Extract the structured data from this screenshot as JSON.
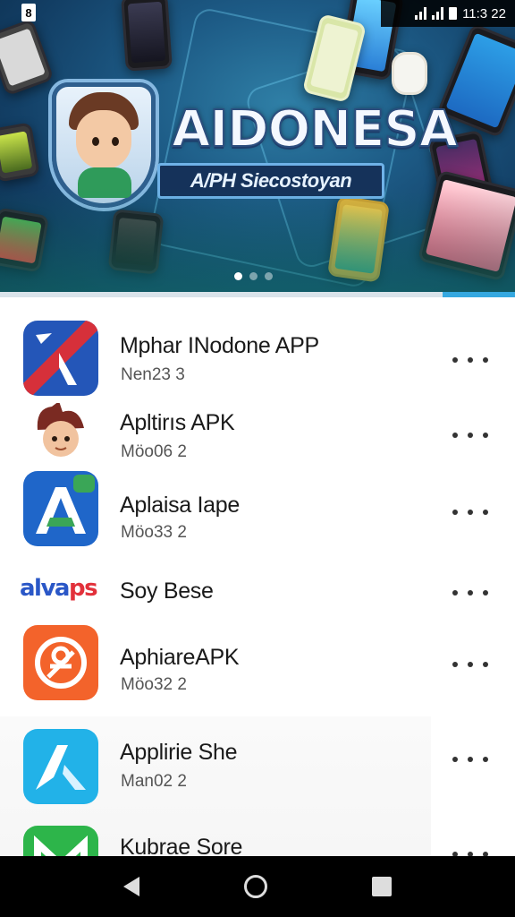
{
  "status_bar": {
    "time": "11:3 22",
    "sim_glyph": "8"
  },
  "banner": {
    "title": "AIDONESA",
    "subtitle": "A/PH Siecostoyan",
    "carousel": {
      "pages": 3,
      "active": 1
    }
  },
  "apps": [
    {
      "title": "Mphar INodone APP",
      "subtitle": "Nen23 3",
      "icon": "blue-slash-icon",
      "colors": [
        "#2456b8",
        "#d6303a"
      ]
    },
    {
      "title": "Apltirıs APK",
      "subtitle": "Möo06 2",
      "icon": "mascot-icon",
      "colors": [
        "#f1c39f",
        "#7a2a22"
      ]
    },
    {
      "title": "Aplaisa Iape",
      "subtitle": "Möo33 2",
      "icon": "a-store-icon",
      "colors": [
        "#1f66c9",
        "#3aa657"
      ]
    },
    {
      "title": "Soy Bese",
      "subtitle": "",
      "icon": "alvaps-logo-icon",
      "logo_text": "alvaps",
      "colors": [
        "#2a57c7",
        "#e2313b"
      ]
    },
    {
      "title": "AphiareAPK",
      "subtitle": "Möo32 2",
      "icon": "orange-badge-icon",
      "colors": [
        "#f3632b",
        "#ffffff"
      ]
    },
    {
      "title": "Applirie She",
      "subtitle": "Man02 2",
      "icon": "cyan-a-icon",
      "colors": [
        "#22b2e8",
        "#ffffff"
      ]
    },
    {
      "title": "Kubrae Sore",
      "subtitle": "",
      "icon": "green-m-icon",
      "colors": [
        "#2db54a",
        "#ffffff"
      ]
    }
  ],
  "nav": {
    "back": "back-icon",
    "home": "home-icon",
    "recents": "recents-icon"
  }
}
